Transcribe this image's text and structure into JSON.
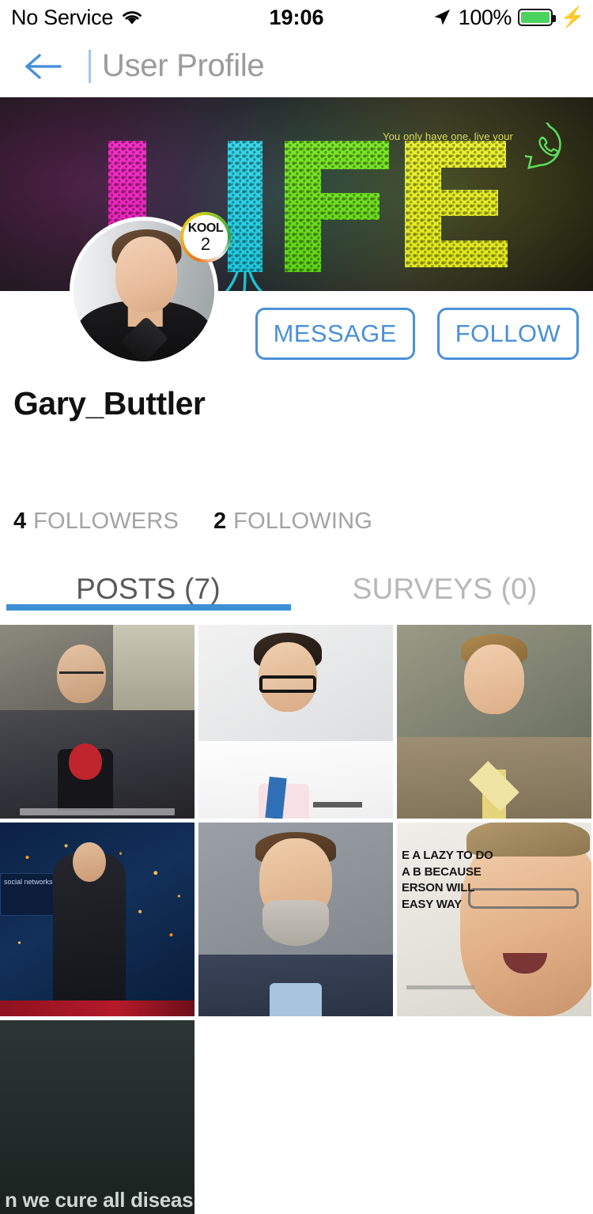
{
  "status_bar": {
    "carrier": "No Service",
    "wifi_icon": "wifi-icon",
    "time": "19:06",
    "location_icon": "location-arrow-icon",
    "battery_percent": "100%",
    "battery_icon": "battery-full-icon",
    "charging_icon": "lightning-bolt-icon"
  },
  "nav": {
    "back_icon": "back-arrow-icon",
    "title": "User Profile"
  },
  "cover": {
    "artwork_word": "LIFE",
    "tagline": "You only have one, live your",
    "whatsapp_icon": "whatsapp-icon"
  },
  "profile": {
    "avatar_icon": "user-avatar",
    "badge": {
      "label": "KOOL",
      "level": "2"
    },
    "username": "Gary_Buttler",
    "buttons": {
      "message": "MESSAGE",
      "follow": "FOLLOW"
    },
    "stats": [
      {
        "count": "4",
        "label": "FOLLOWERS"
      },
      {
        "count": "2",
        "label": "FOLLOWING"
      }
    ]
  },
  "tabs": [
    {
      "label": "POSTS (7)",
      "active": true
    },
    {
      "label": "SURVEYS (0)",
      "active": false
    }
  ],
  "posts": [
    {
      "alt": "man-with-glasses-video-still"
    },
    {
      "alt": "doctor-in-white-coat-portrait"
    },
    {
      "alt": "blond-man-in-tan-suit-portrait"
    },
    {
      "alt": "speaker-on-stage-social-networks",
      "screen_text": "social networks"
    },
    {
      "alt": "bearded-man-grey-background-portrait"
    },
    {
      "alt": "bill-gates-with-lazy-person-quote",
      "quote": "E A LAZY TO DO A B BECAUSE ERSON WILL EASY WAY"
    },
    {
      "alt": "dark-slide-cure-all-diseases",
      "caption": "n we cure all diseas"
    }
  ],
  "colors": {
    "accent_blue": "#4a90d9",
    "tab_underline": "#3d8fd4",
    "battery_green": "#4cd25f",
    "title_gray": "#9b9b9b"
  }
}
